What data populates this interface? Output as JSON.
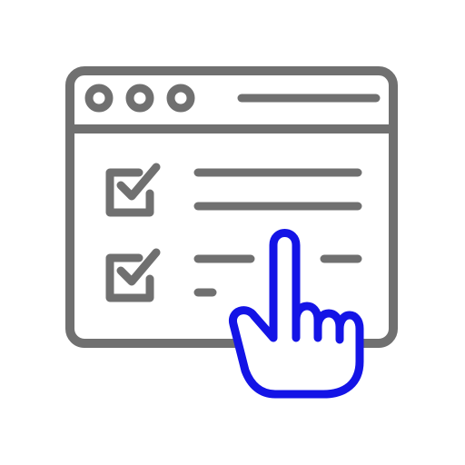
{
  "colors": {
    "background": "#ffffff",
    "outline": "#707070",
    "hand": "#1414e6",
    "hand_fill": "#ffffff"
  },
  "window": {
    "controls": [
      "circle",
      "circle",
      "circle"
    ],
    "title_bar_icon": "title-bar-line"
  },
  "checklist": {
    "items": [
      {
        "checked": true,
        "icon": "checkbox-checked-icon",
        "text_lines": 2
      },
      {
        "checked": true,
        "icon": "checkbox-checked-icon",
        "text_lines": 2
      }
    ]
  },
  "cursor": {
    "icon": "pointing-hand-icon"
  }
}
